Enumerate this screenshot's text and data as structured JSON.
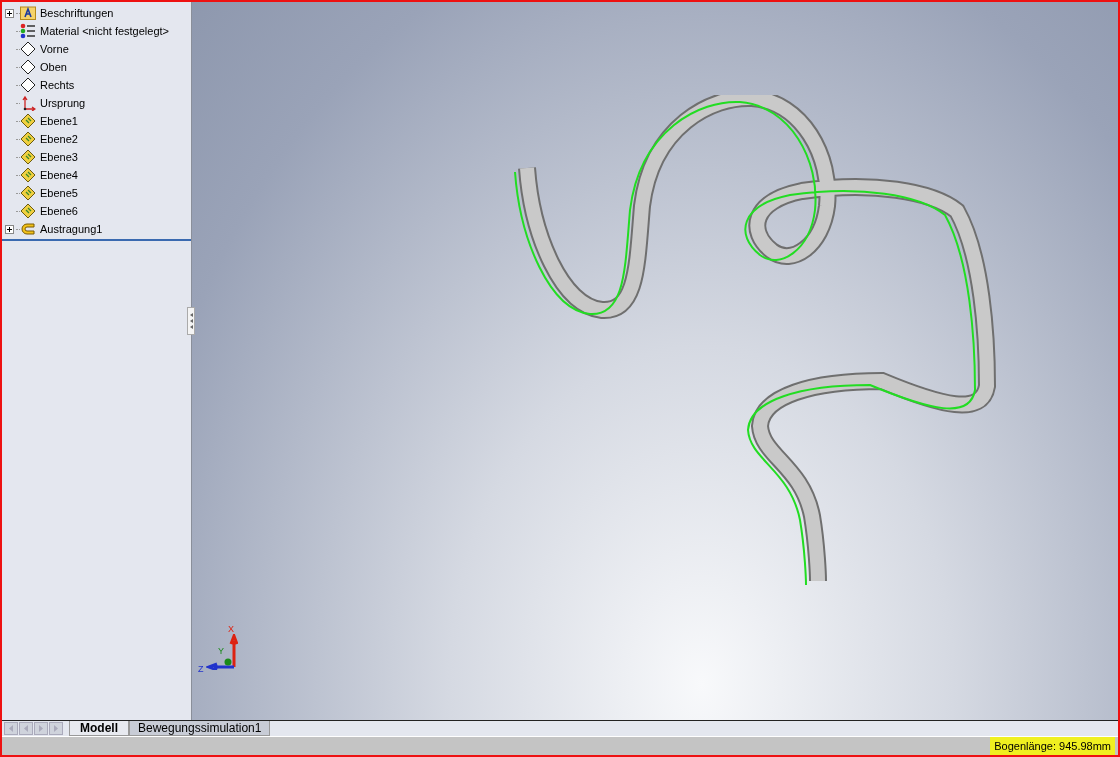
{
  "feature_tree": {
    "items": [
      {
        "kind": "annotations",
        "label": "Beschriftungen",
        "expanded": false
      },
      {
        "kind": "material",
        "label": "Material <nicht festgelegt>"
      },
      {
        "kind": "plane",
        "label": "Vorne"
      },
      {
        "kind": "plane",
        "label": "Oben"
      },
      {
        "kind": "plane",
        "label": "Rechts"
      },
      {
        "kind": "origin",
        "label": "Ursprung"
      },
      {
        "kind": "refplane",
        "label": "Ebene1"
      },
      {
        "kind": "refplane",
        "label": "Ebene2"
      },
      {
        "kind": "refplane",
        "label": "Ebene3"
      },
      {
        "kind": "refplane",
        "label": "Ebene4"
      },
      {
        "kind": "refplane",
        "label": "Ebene5"
      },
      {
        "kind": "refplane",
        "label": "Ebene6"
      },
      {
        "kind": "sweep",
        "label": "Austragung1",
        "expanded": false
      }
    ]
  },
  "viewport": {
    "triad": {
      "x": "X",
      "y": "Y",
      "z": "Z"
    }
  },
  "tabs": [
    {
      "label": "Modell",
      "selected": true
    },
    {
      "label": "Bewegungssimulation1",
      "selected": false
    }
  ],
  "status_bar": {
    "measurement": "Bogenlänge: 945.98mm"
  }
}
